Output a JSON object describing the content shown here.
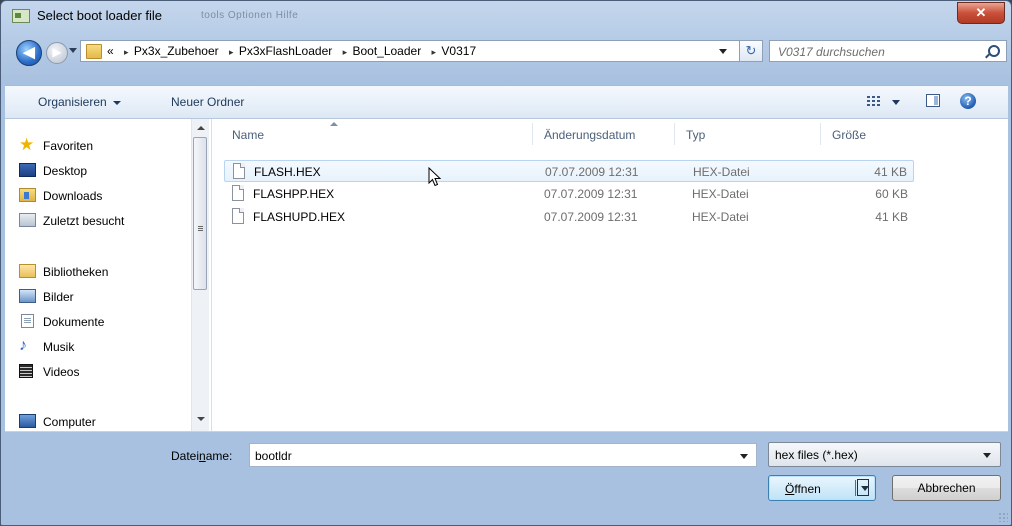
{
  "window": {
    "title": "Select boot loader file",
    "close_glyph": "✕",
    "ghost_menu": "tools     Optionen     Hilfe"
  },
  "nav": {
    "back_glyph": "◀",
    "forward_glyph": "▶"
  },
  "address": {
    "overflow": "«",
    "crumbs": [
      "Px3x_Zubehoer",
      "Px3xFlashLoader",
      "Boot_Loader",
      "V0317"
    ],
    "separator": "▸"
  },
  "refresh_glyph": "↻",
  "search": {
    "placeholder": "V0317 durchsuchen"
  },
  "toolbar": {
    "organize": "Organisieren",
    "new_folder": "Neuer Ordner",
    "help_glyph": "?"
  },
  "sidebar": {
    "favorites": {
      "label": "Favoriten",
      "icon": "star-icon"
    },
    "favorites_items": [
      {
        "label": "Desktop",
        "icon": "desktop-icon"
      },
      {
        "label": "Downloads",
        "icon": "downloads-icon"
      },
      {
        "label": "Zuletzt besucht",
        "icon": "recent-places-icon"
      }
    ],
    "libraries": {
      "label": "Bibliotheken",
      "icon": "library-icon"
    },
    "libraries_items": [
      {
        "label": "Bilder",
        "icon": "pictures-icon"
      },
      {
        "label": "Dokumente",
        "icon": "documents-icon"
      },
      {
        "label": "Musik",
        "icon": "music-icon"
      },
      {
        "label": "Videos",
        "icon": "videos-icon"
      }
    ],
    "computer": {
      "label": "Computer",
      "icon": "computer-icon"
    }
  },
  "files": {
    "columns": {
      "name": "Name",
      "date": "Änderungsdatum",
      "type": "Typ",
      "size": "Größe"
    },
    "rows": [
      {
        "name": "FLASH.HEX",
        "date": "07.07.2009 12:31",
        "type": "HEX-Datei",
        "size": "41 KB"
      },
      {
        "name": "FLASHPP.HEX",
        "date": "07.07.2009 12:31",
        "type": "HEX-Datei",
        "size": "60 KB"
      },
      {
        "name": "FLASHUPD.HEX",
        "date": "07.07.2009 12:31",
        "type": "HEX-Datei",
        "size": "41 KB"
      }
    ],
    "hovered_row": 0
  },
  "filename": {
    "label_pre": "Datei",
    "label_ul": "n",
    "label_post": "ame:",
    "value": "bootldr"
  },
  "filter": {
    "value": "hex files (*.hex)"
  },
  "buttons": {
    "open_ul": "Ö",
    "open_rest": "ffnen",
    "cancel": "Abbrechen"
  },
  "colors": {
    "accent": "#3c7fb1",
    "hover_row": "#e8f2fc",
    "frame": "#b5cbe6"
  }
}
